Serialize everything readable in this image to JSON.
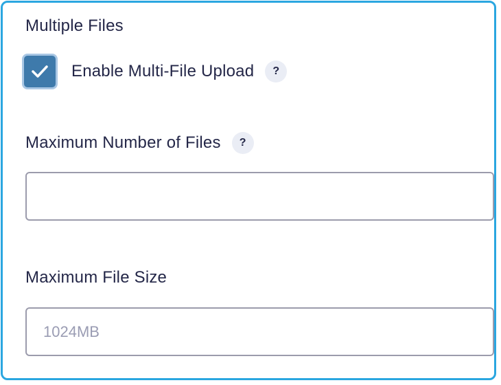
{
  "section": {
    "title": "Multiple Files"
  },
  "multi_file": {
    "label": "Enable Multi-File Upload",
    "checked": true,
    "help_glyph": "?"
  },
  "max_files": {
    "label": "Maximum Number of Files",
    "help_glyph": "?",
    "value": "",
    "placeholder": ""
  },
  "max_size": {
    "label": "Maximum File Size",
    "value": "",
    "placeholder": "1024MB"
  },
  "colors": {
    "accent_border": "#2aa6e0",
    "checkbox_fill": "#3e7aab",
    "text": "#242748"
  },
  "icons": {
    "checkmark": "check-icon",
    "help": "question-mark-icon"
  }
}
